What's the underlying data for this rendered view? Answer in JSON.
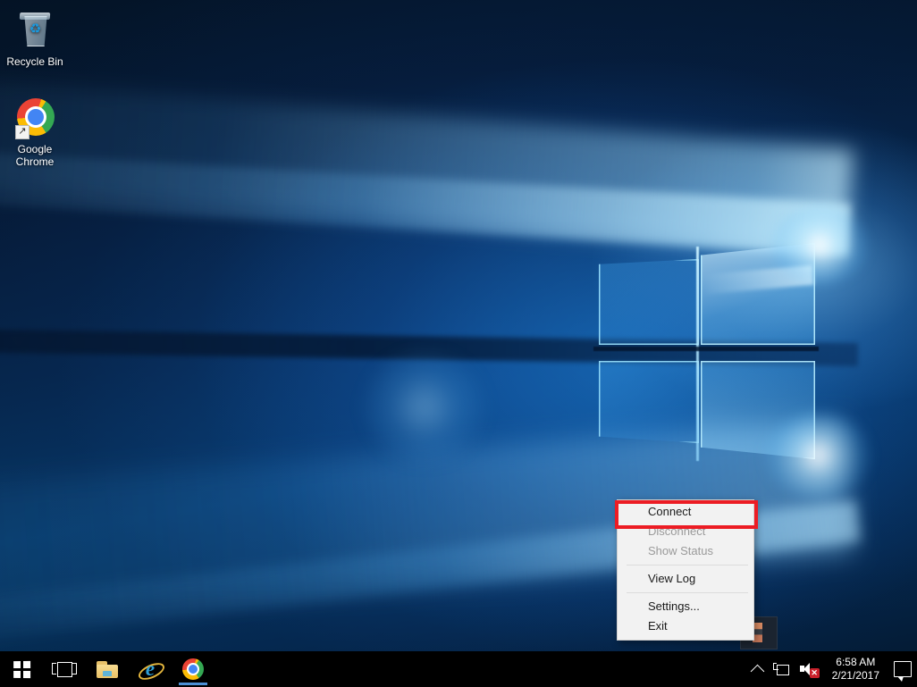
{
  "desktop": {
    "icons": [
      {
        "label": "Recycle Bin",
        "icon": "recycle-bin-icon"
      },
      {
        "label": "Google\nChrome",
        "label_line1": "Google",
        "label_line2": "Chrome",
        "icon": "google-chrome-icon"
      }
    ]
  },
  "context_menu": {
    "items": [
      {
        "label": "Connect",
        "enabled": true,
        "highlighted": true
      },
      {
        "label": "Disconnect",
        "enabled": false,
        "highlighted": false
      },
      {
        "label": "Show Status",
        "enabled": false,
        "highlighted": false
      },
      {
        "label": "View Log",
        "enabled": true,
        "highlighted": false
      },
      {
        "label": "Settings...",
        "enabled": true,
        "highlighted": false
      },
      {
        "label": "Exit",
        "enabled": true,
        "highlighted": false
      }
    ],
    "annotation_color": "#ec1c24",
    "background_color": "#f2f2f2"
  },
  "taskbar": {
    "background_color": "#000000",
    "buttons": [
      {
        "name": "start-button",
        "icon": "windows-logo-icon",
        "label": "Start"
      },
      {
        "name": "task-view-button",
        "icon": "task-view-icon",
        "label": "Task View"
      },
      {
        "name": "file-explorer-button",
        "icon": "folder-icon",
        "label": "File Explorer"
      },
      {
        "name": "internet-explorer-button",
        "icon": "internet-explorer-icon",
        "label": "Internet Explorer"
      },
      {
        "name": "chrome-button",
        "icon": "google-chrome-icon",
        "label": "Google Chrome",
        "running": true
      }
    ],
    "tray": {
      "show_hidden_icons": {
        "icon": "chevron-up-icon",
        "label": "Show hidden icons"
      },
      "network": {
        "icon": "network-icon",
        "label": "Network"
      },
      "volume": {
        "icon": "speaker-muted-icon",
        "label": "Volume muted",
        "badge": "✕",
        "badge_color": "#c9202a"
      },
      "clock": {
        "time": "6:58 AM",
        "date": "2/21/2017"
      },
      "action_center": {
        "icon": "action-center-icon",
        "label": "Action Center"
      }
    }
  }
}
